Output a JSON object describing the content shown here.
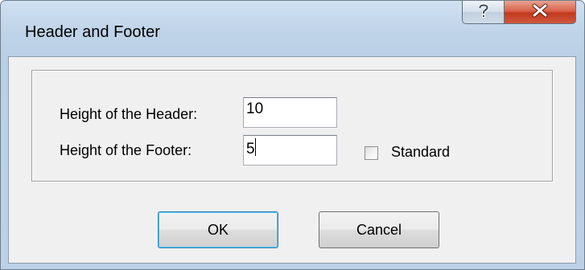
{
  "window": {
    "title": "Header and Footer",
    "help_icon": "question-mark-icon",
    "close_icon": "close-x-icon"
  },
  "form": {
    "header_label": "Height of the Header:",
    "header_value": "10",
    "footer_label": "Height of the Footer:",
    "footer_value": "5",
    "standard_label": "Standard",
    "standard_checked": false
  },
  "buttons": {
    "ok_label": "OK",
    "cancel_label": "Cancel"
  },
  "colors": {
    "close_button": "#c7432a",
    "title_bar": "#bfd3e8",
    "dialog_face": "#f0f0f0"
  }
}
